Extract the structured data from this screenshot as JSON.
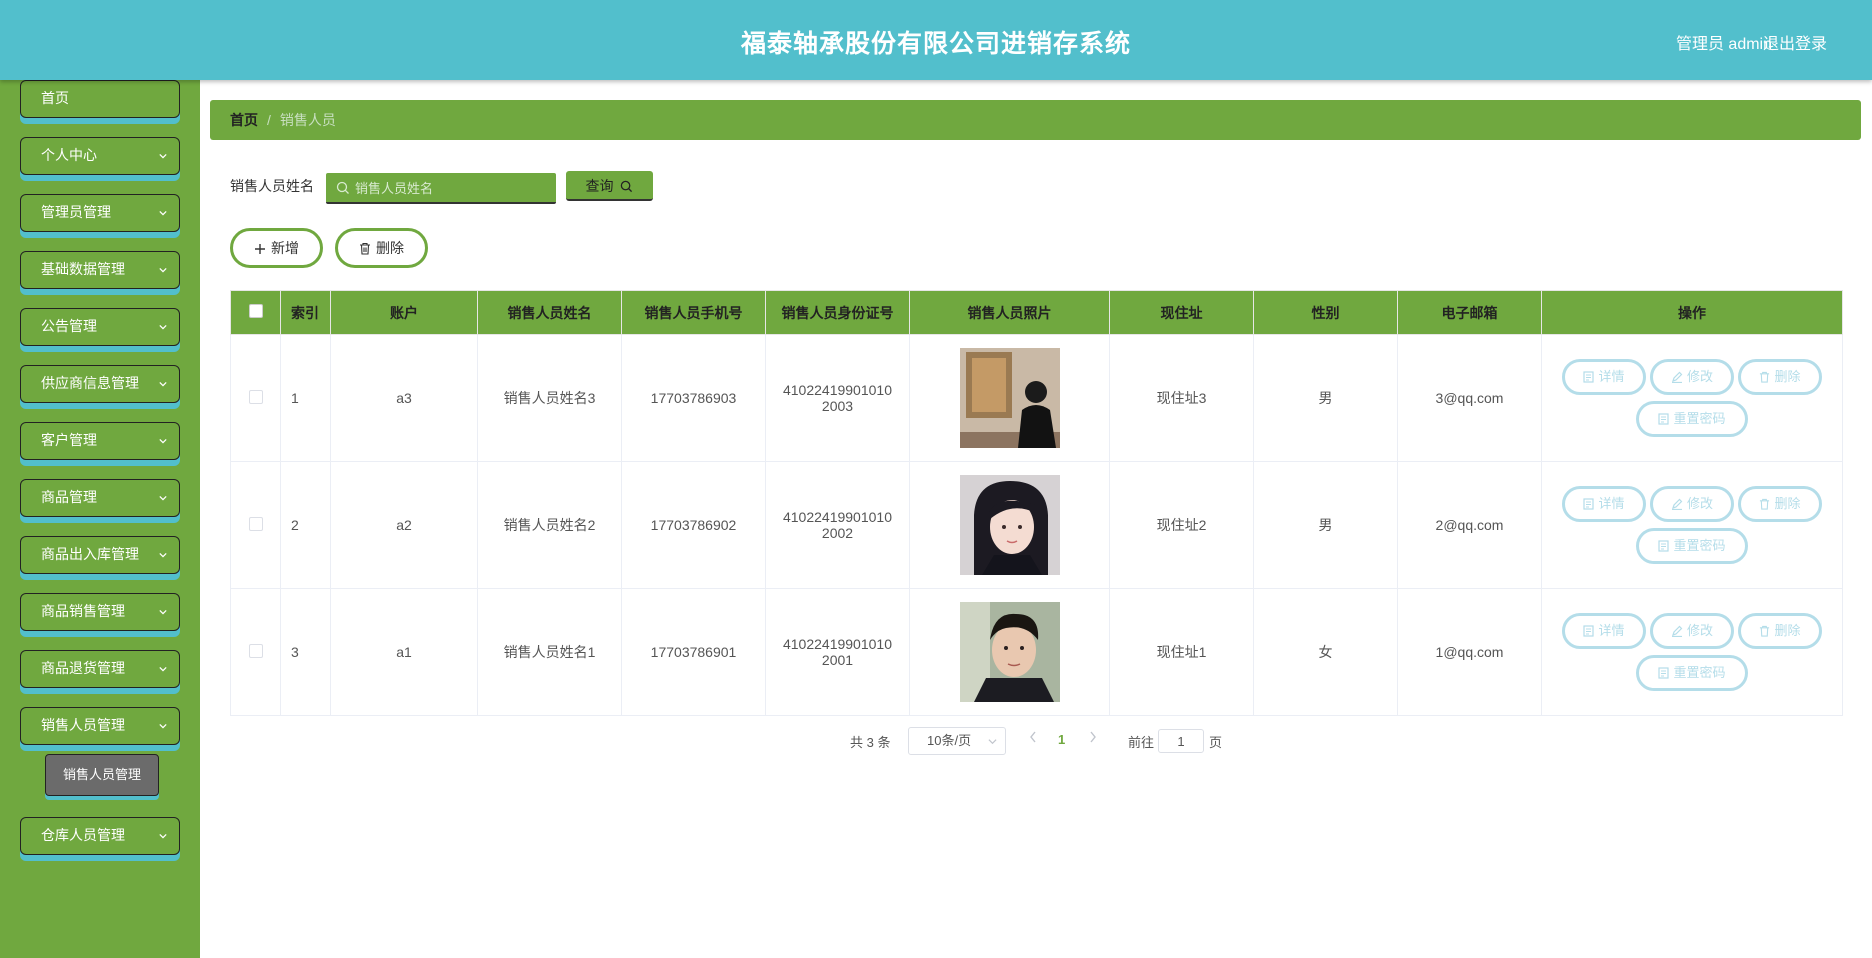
{
  "header": {
    "title": "福泰轴承股份有限公司进销存系统",
    "user_label": "管理员 admin",
    "logout": "退出登录"
  },
  "sidebar": {
    "items": [
      {
        "label": "首页"
      },
      {
        "label": "个人中心"
      },
      {
        "label": "管理员管理"
      },
      {
        "label": "基础数据管理"
      },
      {
        "label": "公告管理"
      },
      {
        "label": "供应商信息管理"
      },
      {
        "label": "客户管理"
      },
      {
        "label": "商品管理"
      },
      {
        "label": "商品出入库管理"
      },
      {
        "label": "商品销售管理"
      },
      {
        "label": "商品退货管理"
      },
      {
        "label": "销售人员管理"
      },
      {
        "label": "仓库人员管理"
      }
    ],
    "sub_item": "销售人员管理"
  },
  "breadcrumb": {
    "home": "首页",
    "separator": "/",
    "current": "销售人员"
  },
  "search": {
    "label": "销售人员姓名",
    "placeholder": "销售人员姓名",
    "button": "查询"
  },
  "actions": {
    "add": "新增",
    "delete": "删除"
  },
  "table": {
    "columns": [
      "索引",
      "账户",
      "销售人员姓名",
      "销售人员手机号",
      "销售人员身份证号",
      "销售人员照片",
      "现住址",
      "性别",
      "电子邮箱",
      "操作"
    ],
    "rows": [
      {
        "index": "1",
        "account": "a3",
        "name": "销售人员姓名3",
        "phone": "17703786903",
        "id_line1": "41022419901010",
        "id_line2": "2003",
        "address": "现住址3",
        "gender": "男",
        "email": "3@qq.com"
      },
      {
        "index": "2",
        "account": "a2",
        "name": "销售人员姓名2",
        "phone": "17703786902",
        "id_line1": "41022419901010",
        "id_line2": "2002",
        "address": "现住址2",
        "gender": "男",
        "email": "2@qq.com"
      },
      {
        "index": "3",
        "account": "a1",
        "name": "销售人员姓名1",
        "phone": "17703786901",
        "id_line1": "41022419901010",
        "id_line2": "2001",
        "address": "现住址1",
        "gender": "女",
        "email": "1@qq.com"
      }
    ],
    "op_labels": {
      "detail": "详情",
      "edit": "修改",
      "delete": "删除",
      "reset": "重置密码"
    }
  },
  "pagination": {
    "total": "共 3 条",
    "page_size": "10条/页",
    "current_page": "1",
    "goto_label": "前往",
    "goto_value": "1",
    "page_unit": "页"
  },
  "colors": {
    "header_bg": "#52bfcc",
    "accent_green": "#70a83f",
    "op_button": "#b4dde9"
  }
}
